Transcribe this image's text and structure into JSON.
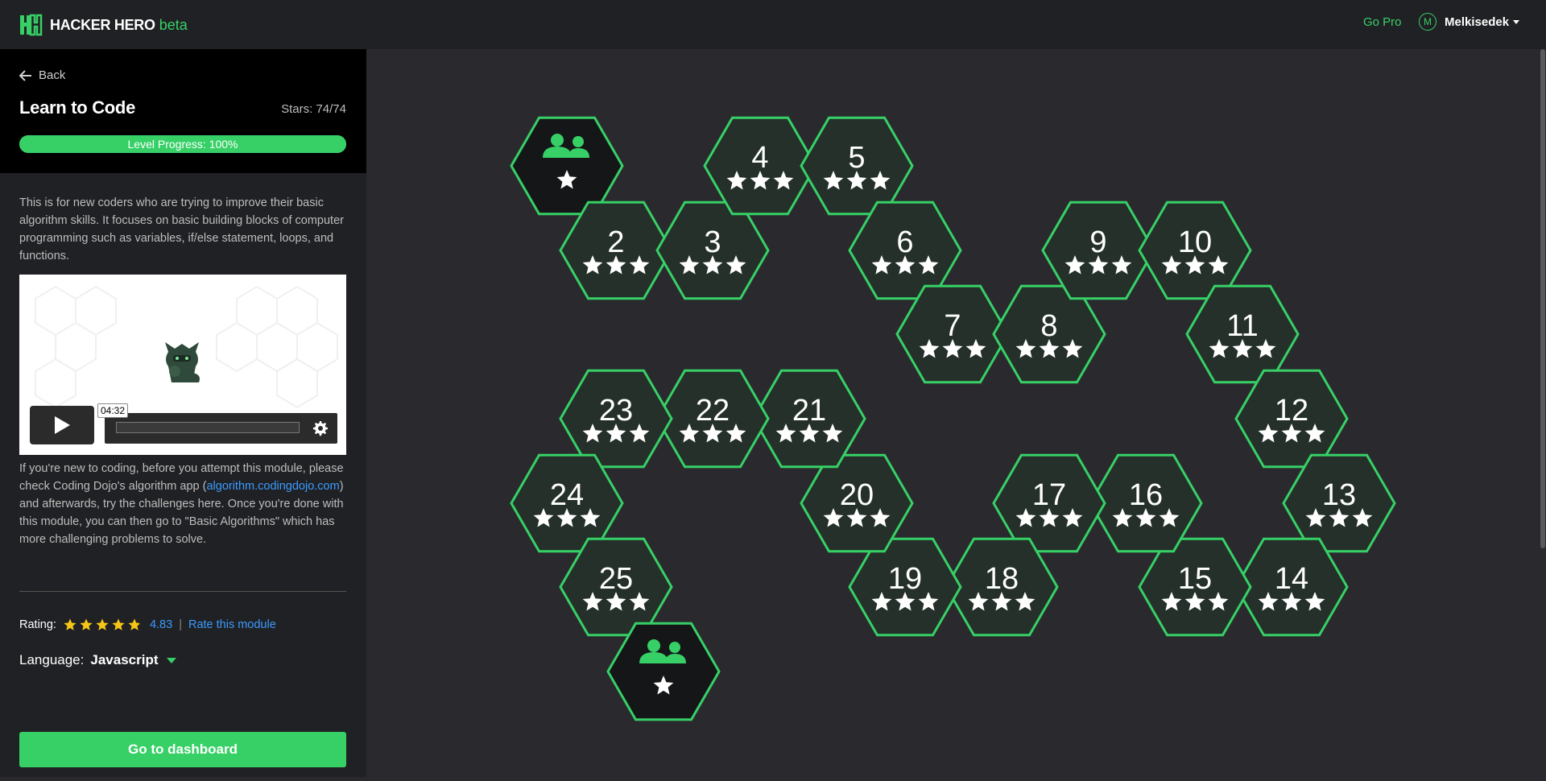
{
  "header": {
    "brand": "HACKER HERO",
    "brand_suffix": "beta",
    "go_pro": "Go Pro",
    "avatar_letter": "M",
    "username": "Melkisedek"
  },
  "sidebar": {
    "back_label": "Back",
    "title": "Learn to Code",
    "stars": "Stars: 74/74",
    "progress_label": "Level Progress: 100%",
    "progress_value": 1.0,
    "description": "This is for new coders who are trying to improve their basic algorithm skills. It focuses on basic building blocks of computer programming such as variables, if/else statement, loops, and functions.",
    "video_time": "04:32",
    "note_before": "If you're new to coding, before you attempt this module, please check Coding Dojo's algorithm app (",
    "note_link": "algorithm.codingdojo.com",
    "note_after": ") and afterwards, try the challenges here. Once you're done with this module, you can then go to \"Basic Algorithms\" which has more challenging problems to solve.",
    "rating_label": "Rating:",
    "rating_value": "4.83",
    "rating_stars": 4.83,
    "rate_link": "Rate this module",
    "language_label": "Language:",
    "language_value": "Javascript",
    "dashboard_button": "Go to dashboard"
  },
  "levels": [
    {
      "id": "group-1",
      "label": "",
      "type": "group",
      "stars": 1
    },
    {
      "id": "2",
      "label": "2",
      "type": "level",
      "stars": 3
    },
    {
      "id": "3",
      "label": "3",
      "type": "level",
      "stars": 3
    },
    {
      "id": "4",
      "label": "4",
      "type": "level",
      "stars": 3
    },
    {
      "id": "5",
      "label": "5",
      "type": "level",
      "stars": 3
    },
    {
      "id": "6",
      "label": "6",
      "type": "level",
      "stars": 3
    },
    {
      "id": "7",
      "label": "7",
      "type": "level",
      "stars": 3
    },
    {
      "id": "8",
      "label": "8",
      "type": "level",
      "stars": 3
    },
    {
      "id": "9",
      "label": "9",
      "type": "level",
      "stars": 3
    },
    {
      "id": "10",
      "label": "10",
      "type": "level",
      "stars": 3
    },
    {
      "id": "11",
      "label": "11",
      "type": "level",
      "stars": 3
    },
    {
      "id": "12",
      "label": "12",
      "type": "level",
      "stars": 3
    },
    {
      "id": "13",
      "label": "13",
      "type": "level",
      "stars": 3
    },
    {
      "id": "14",
      "label": "14",
      "type": "level",
      "stars": 3
    },
    {
      "id": "15",
      "label": "15",
      "type": "level",
      "stars": 3
    },
    {
      "id": "16",
      "label": "16",
      "type": "level",
      "stars": 3
    },
    {
      "id": "17",
      "label": "17",
      "type": "level",
      "stars": 3
    },
    {
      "id": "18",
      "label": "18",
      "type": "level",
      "stars": 3
    },
    {
      "id": "19",
      "label": "19",
      "type": "level",
      "stars": 3
    },
    {
      "id": "20",
      "label": "20",
      "type": "level",
      "stars": 3
    },
    {
      "id": "21",
      "label": "21",
      "type": "level",
      "stars": 3
    },
    {
      "id": "22",
      "label": "22",
      "type": "level",
      "stars": 3
    },
    {
      "id": "23",
      "label": "23",
      "type": "level",
      "stars": 3
    },
    {
      "id": "24",
      "label": "24",
      "type": "level",
      "stars": 3
    },
    {
      "id": "25",
      "label": "25",
      "type": "level",
      "stars": 3
    },
    {
      "id": "group-2",
      "label": "",
      "type": "group",
      "stars": 1
    }
  ],
  "colors": {
    "accent": "#37d067",
    "hex_fill": "#243029",
    "group_fill": "#141618",
    "link": "#3a9bff"
  }
}
